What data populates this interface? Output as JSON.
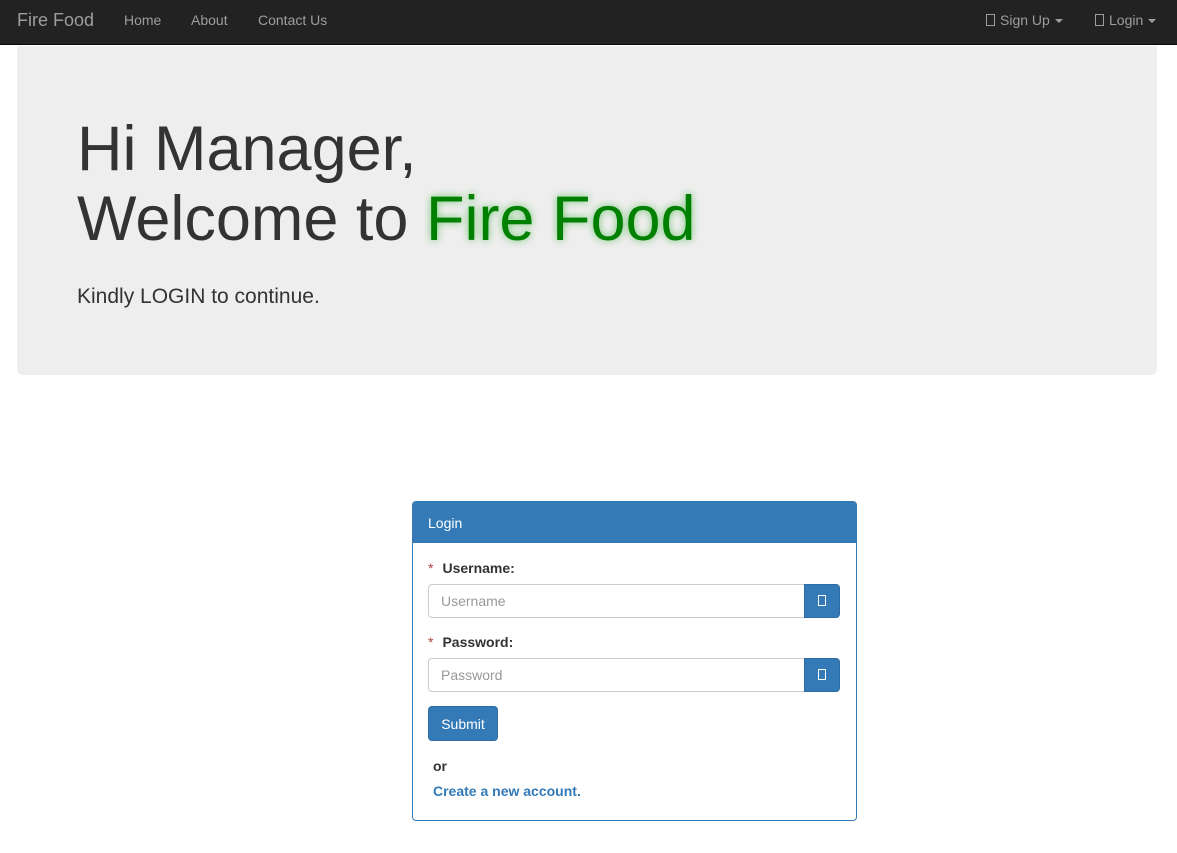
{
  "navbar": {
    "brand": "Fire Food",
    "links": [
      {
        "label": "Home"
      },
      {
        "label": "About"
      },
      {
        "label": "Contact Us"
      }
    ],
    "right": [
      {
        "label": "Sign Up",
        "icon": "user-icon"
      },
      {
        "label": "Login",
        "icon": "login-icon"
      }
    ]
  },
  "jumbotron": {
    "greeting": "Hi Manager,",
    "welcome_prefix": "Welcome to ",
    "welcome_brand": "Fire Food",
    "lead": "Kindly LOGIN to continue."
  },
  "login_panel": {
    "title": "Login",
    "username": {
      "label": "Username:",
      "placeholder": "Username",
      "value": "",
      "icon": "user-icon"
    },
    "password": {
      "label": "Password:",
      "placeholder": "Password",
      "value": "",
      "icon": "lock-icon"
    },
    "required_marker": "*",
    "submit_label": "Submit",
    "or_text": "or",
    "create_account_link": "Create a new account."
  },
  "colors": {
    "navbar_bg": "#222222",
    "primary": "#337ab7",
    "brand_green": "#008000",
    "jumbotron_bg": "#eeeeee"
  }
}
